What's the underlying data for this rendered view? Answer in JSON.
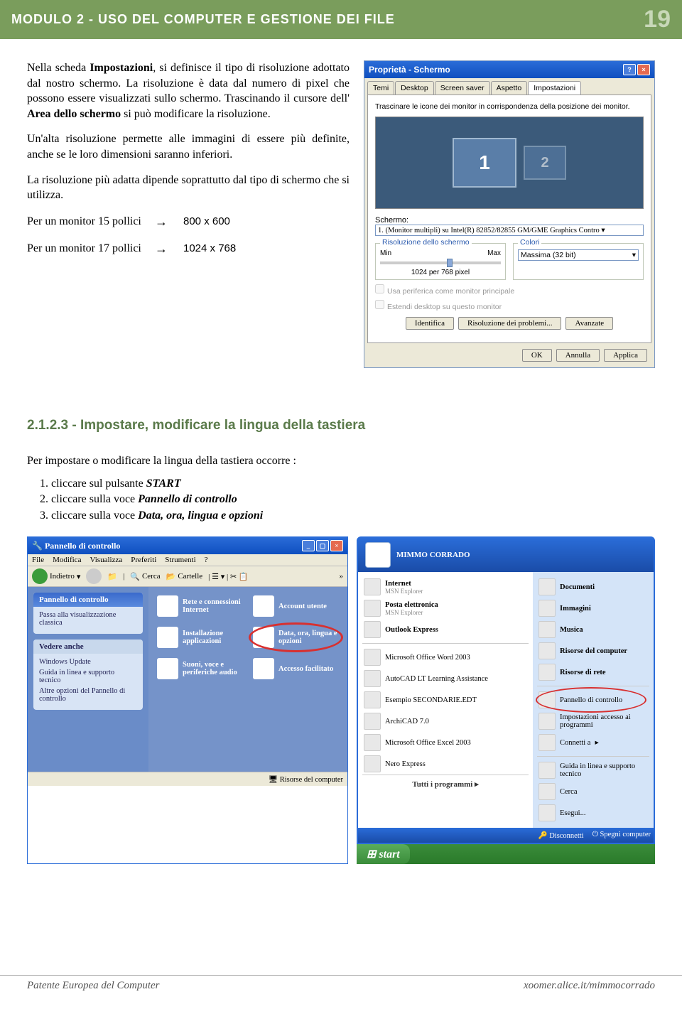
{
  "header": {
    "title": "MODULO 2 - USO DEL COMPUTER E GESTIONE DEI FILE",
    "page_num": "19"
  },
  "intro_para1_a": "Nella scheda ",
  "intro_para1_b": "Impostazioni",
  "intro_para1_c": ", si definisce il tipo di risoluzione adottato dal nostro schermo. La risoluzione è data dal numero di pixel che possono essere visualizzati sullo schermo. Trascinando il cursore dell' ",
  "intro_para1_d": "Area dello schermo",
  "intro_para1_e": " si può modificare la risoluzione.",
  "intro_para2": "Un'alta risoluzione permette alle immagini di essere più definite, anche se le loro dimensioni saranno inferiori.",
  "intro_para3": "La risoluzione più adatta dipende soprattutto dal tipo di schermo che si utilizza.",
  "res15_label": "Per un monitor 15 pollici",
  "res15_val": "800 x 600",
  "res17_label": "Per un monitor 17 pollici",
  "res17_val": "1024 x 768",
  "arrow": "→",
  "dialog": {
    "title": "Proprietà - Schermo",
    "tabs": [
      "Temi",
      "Desktop",
      "Screen saver",
      "Aspetto",
      "Impostazioni"
    ],
    "active_tab": "Impostazioni",
    "hint": "Trascinare le icone dei monitor in corrispondenza della posizione dei monitor.",
    "mon1": "1",
    "mon2": "2",
    "schermo_label": "Schermo:",
    "schermo_val": "1. (Monitor multipli) su Intel(R) 82852/82855 GM/GME Graphics Contro",
    "res_legend": "Risoluzione dello schermo",
    "res_min": "Min",
    "res_max": "Max",
    "res_val": "1024 per 768 pixel",
    "col_legend": "Colori",
    "col_val": "Massima (32 bit)",
    "chk1": "Usa periferica come monitor principale",
    "chk2": "Estendi desktop su questo monitor",
    "btn_ident": "Identifica",
    "btn_troub": "Risoluzione dei problemi...",
    "btn_adv": "Avanzate",
    "btn_ok": "OK",
    "btn_cancel": "Annulla",
    "btn_apply": "Applica"
  },
  "section_title": "2.1.2.3 - Impostare, modificare la lingua della tastiera",
  "para2": "Per impostare o modificare la lingua della tastiera occorre :",
  "steps": {
    "s1a": "cliccare sul pulsante ",
    "s1b": "START",
    "s2a": "cliccare sulla voce ",
    "s2b": "Pannello di controllo",
    "s3a": "cliccare sulla voce ",
    "s3b": "Data, ora, lingua e opzioni"
  },
  "cp": {
    "title": "Pannello di controllo",
    "menu": [
      "File",
      "Modifica",
      "Visualizza",
      "Preferiti",
      "Strumenti",
      "?"
    ],
    "back": "Indietro",
    "search": "Cerca",
    "folders": "Cartelle",
    "side_title": "Pannello di controllo",
    "side_switch": "Passa alla visualizzazione classica",
    "see_also": "Vedere anche",
    "see1": "Windows Update",
    "see2": "Guida in linea e supporto tecnico",
    "see3": "Altre opzioni del Pannello di controllo",
    "it1": "Rete e connessioni Internet",
    "it2": "Account utente",
    "it3": "Installazione applicazioni",
    "it4": "Data, ora, lingua e opzioni",
    "it5": "Suoni, voce e periferiche audio",
    "it6": "Accesso facilitato",
    "foot": "Risorse del computer"
  },
  "sm": {
    "user": "MIMMO CORRADO",
    "l1": "Internet",
    "l1s": "MSN Explorer",
    "l2": "Posta elettronica",
    "l2s": "MSN Explorer",
    "l3": "Outlook Express",
    "l4": "Microsoft Office Word 2003",
    "l5": "AutoCAD LT Learning Assistance",
    "l6": "Esempio SECONDARIE.EDT",
    "l7": "ArchiCAD 7.0",
    "l8": "Microsoft Office Excel 2003",
    "l9": "Nero Express",
    "all": "Tutti i programmi",
    "r1": "Documenti",
    "r2": "Immagini",
    "r3": "Musica",
    "r4": "Risorse del computer",
    "r5": "Risorse di rete",
    "r6": "Pannello di controllo",
    "r7": "Impostazioni accesso ai programmi",
    "r8": "Connetti a",
    "r9": "Guida in linea e supporto tecnico",
    "r10": "Cerca",
    "r11": "Esegui...",
    "logoff": "Disconnetti",
    "shutdown": "Spegni computer",
    "start": "start"
  },
  "footer": {
    "left": "Patente Europea del Computer",
    "right": "xoomer.alice.it/mimmocorrado"
  }
}
